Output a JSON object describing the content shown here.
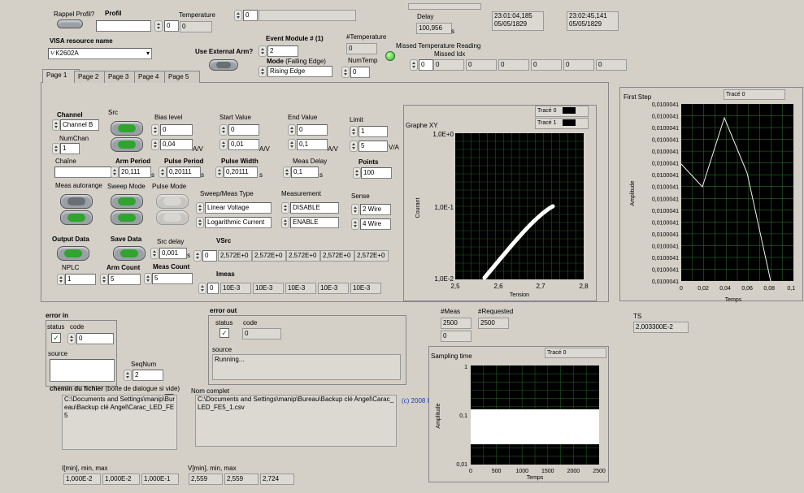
{
  "top": {
    "rappel_label": "Rappel Profil?",
    "profil_label": "Profil",
    "temperature_label": "Temperature",
    "temperature_value": "0",
    "profil_num": "0",
    "top_num": "0",
    "delay_label": "Delay",
    "delay_value": "100,956",
    "delay_unit": "s",
    "time1": "23:01:04,185",
    "date1": "05/05/1829",
    "time2": "23:02:45,141",
    "date2": "05/05/1829"
  },
  "visa": {
    "label": "VISA resource name",
    "value": "K2602A"
  },
  "event_module": {
    "label": "Event Module # (1)",
    "value": "2"
  },
  "use_external_arm": "Use External Arm?",
  "mode": {
    "label": "Mode",
    "label_suffix": "(Falling Edge)",
    "value": "Rising Edge"
  },
  "num_temperature": {
    "label": "#Temperature",
    "value": "0"
  },
  "num_temp": {
    "label": "NumTemp",
    "value": "0"
  },
  "missed": {
    "label": "Missed Temperature Reading",
    "idx_label": "Missed Idx",
    "idx_value": "0",
    "values": [
      "0",
      "0",
      "0",
      "0",
      "0",
      "0"
    ]
  },
  "tabs": [
    "Page 1",
    "Page 2",
    "Page 3",
    "Page 4",
    "Page 5"
  ],
  "page1": {
    "channel_label": "Channel",
    "channel_value": "Channel B",
    "src_label": "Src",
    "numchan_label": "NumChan",
    "numchan_value": "1",
    "bias_label": "Bias level",
    "bias_values": [
      "0",
      "0,04"
    ],
    "bias_unit": "A/V",
    "start_label": "Start Value",
    "start_values": [
      "0",
      "0,01"
    ],
    "start_unit": "A/V",
    "end_label": "End Value",
    "end_values": [
      "0",
      "0,1"
    ],
    "end_unit": "A/V",
    "limit_label": "Limit",
    "limit_values": [
      "1",
      "5"
    ],
    "limit_unit": "V/A",
    "chaine_label": "Chaîne",
    "chaine_value": "",
    "arm_period_label": "Arm Period",
    "arm_period_value": "20,111",
    "arm_period_unit": "s",
    "pulse_period_label": "Pulse Period",
    "pulse_period_value": "0,20111",
    "pulse_period_unit": "s",
    "pulse_width_label": "Pulse Width",
    "pulse_width_value": "0,20111",
    "pulse_width_unit": "s",
    "meas_delay_label": "Meas Delay",
    "meas_delay_value": "0,1",
    "meas_delay_unit": "s",
    "points_label": "Points",
    "points_value": "100",
    "meas_autorange_label": "Meas autorange",
    "sweep_mode_label": "Sweep Mode",
    "pulse_mode_label": "Pulse Mode",
    "sweep_meas_type_label": "Sweep/Meas Type",
    "sweep_meas_type_values": [
      "Linear Voltage",
      "Logarithmic Current"
    ],
    "measurement_label": "Measurement",
    "measurement_values": [
      "DISABLE",
      "ENABLE"
    ],
    "sense_label": "Sense",
    "sense_values": [
      "2 Wire",
      "4 Wire"
    ],
    "output_data_label": "Output Data",
    "save_data_label": "Save Data",
    "src_delay_label": "Src delay",
    "src_delay_value": "0,001",
    "src_delay_unit": "s",
    "vsrc_label": "VSrc",
    "vsrc_index": "0",
    "vsrc_values": [
      "2,572E+0",
      "2,572E+0",
      "2,572E+0",
      "2,572E+0",
      "2,572E+0"
    ],
    "nplc_label": "NPLC",
    "nplc_value": "1",
    "arm_count_label": "Arm Count",
    "arm_count_value": "5",
    "meas_count_label": "Meas Count",
    "meas_count_value": "5",
    "imeas_label": "Imeas",
    "imeas_index": "0",
    "imeas_values": [
      "10E-3",
      "10E-3",
      "10E-3",
      "10E-3",
      "10E-3"
    ]
  },
  "graph_xy": {
    "title": "Graphe XY",
    "legend": [
      "Tracé 0",
      "Tracé 1"
    ],
    "legend_colors": [
      "#ffffff",
      "#ff2020"
    ],
    "xlabel": "Tension",
    "ylabel": "Courant",
    "xticks": [
      "2,5",
      "2,6",
      "2,7",
      "2,8"
    ],
    "yticks": [
      "1,0E+0",
      "1,0E-1",
      "1,0E-2"
    ]
  },
  "first_step": {
    "title": "First Step",
    "legend": "Tracé 0",
    "xlabel": "Temps",
    "ylabel": "Amplitude",
    "xticks": [
      "0",
      "0,02",
      "0,04",
      "0,06",
      "0,08",
      "0,1"
    ],
    "yticks": [
      "0,0100041",
      "0,0100041",
      "0,0100041",
      "0,0100041",
      "0,0100041",
      "0,0100041",
      "0,0100041",
      "0,0100041",
      "0,0100041",
      "0,0100041",
      "0,0100041",
      "0,0100041",
      "0,0100041",
      "0,0100041",
      "0,0100041",
      "0,0100041"
    ]
  },
  "ts": {
    "label": "TS",
    "value": "2,003300E-2"
  },
  "meas": {
    "label": "#Meas",
    "value": "2500",
    "sub_value": "0",
    "requested_label": "#Requested",
    "requested_value": "2500"
  },
  "sampling": {
    "title": "Sampling time",
    "legend": "Tracé 0",
    "xlabel": "Temps",
    "ylabel": "Amplitude",
    "xticks": [
      "0",
      "500",
      "1000",
      "1500",
      "2000",
      "2500"
    ],
    "yticks": [
      "1",
      "0,1",
      "0,01"
    ]
  },
  "error_in": {
    "label": "error in",
    "status_label": "status",
    "code_label": "code",
    "code_value": "0",
    "source_label": "source",
    "source_value": ""
  },
  "error_out": {
    "label": "error out",
    "status_label": "status",
    "code_label": "code",
    "code_value": "0",
    "source_label": "source",
    "source_value": "Running..."
  },
  "seqnum": {
    "label": "SeqNum",
    "value": "2"
  },
  "chemin": {
    "label": "chemin du fichier",
    "label_suffix": "(boîte de dialogue si vide)",
    "value": "C:\\Documents and Settings\\manip\\Bureau\\Backup clé Angel\\Carac_LED_FE5"
  },
  "nom_complet": {
    "label": "Nom complet",
    "value": "C:\\Documents and Settings\\manip\\Bureau\\Backup clé Angel\\Carac_LED_FE5_1.csv"
  },
  "copyright": "(c) 2008 I",
  "i_minmax": {
    "label": "I[min], min, max",
    "values": [
      "1,000E-2",
      "1,000E-2",
      "1,000E-1"
    ]
  },
  "v_minmax": {
    "label": "V[min], min, max",
    "values": [
      "2,559",
      "2,559",
      "2,724"
    ]
  }
}
